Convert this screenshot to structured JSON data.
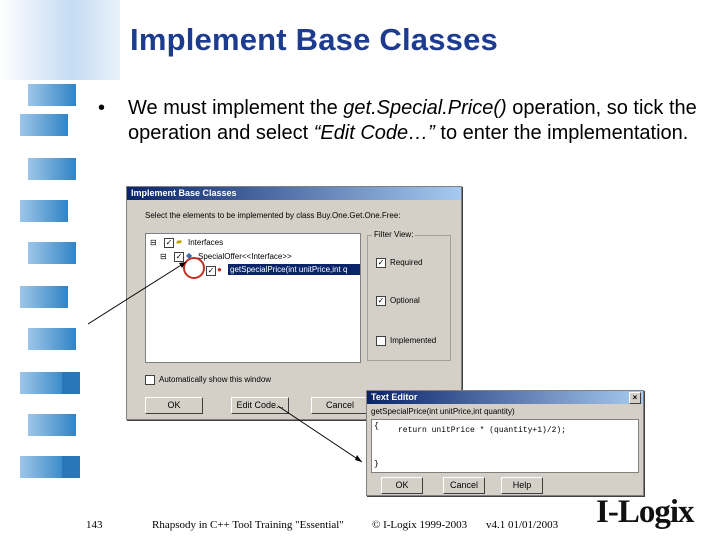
{
  "slide": {
    "title": "Implement Base Classes",
    "bullet_dot": "•",
    "bullet_part1": "We must implement the ",
    "bullet_italic1": "get.Special.Price()",
    "bullet_part2": " operation, so tick the operation and select ",
    "bullet_italic2": "“Edit Code…”",
    "bullet_part3": " to enter the implementation."
  },
  "dialog_base": {
    "title": "Implement Base Classes",
    "instruction": "Select the elements to be implemented by class Buy.One.Get.One.Free:",
    "tree": {
      "root": "Interfaces",
      "child": "SpecialOffer<<Interface>>",
      "leaf": "getSpecialPrice(int unitPrice,int q"
    },
    "filter": {
      "title": "Filter View:",
      "options": [
        {
          "label": "Required",
          "checked": true
        },
        {
          "label": "Optional",
          "checked": true
        },
        {
          "label": "Implemented",
          "checked": false
        }
      ]
    },
    "auto_show_label": "Automatically show this window",
    "buttons": {
      "ok": "OK",
      "edit_code": "Edit Code...",
      "cancel": "Cancel"
    }
  },
  "dialog_editor": {
    "title": "Text Editor",
    "signature": "getSpecialPrice(int unitPrice,int quantity)",
    "code": "return unitPrice * (quantity+1)/2);",
    "closing": "}",
    "buttons": {
      "ok": "OK",
      "cancel": "Cancel",
      "help": "Help"
    }
  },
  "footer": {
    "page_number": "143",
    "course": "Rhapsody in C++ Tool Training \"Essential\"",
    "copyright": "© I-Logix 1999-2003",
    "version": "v4.1 01/01/2003",
    "logo": "I-Logix"
  }
}
